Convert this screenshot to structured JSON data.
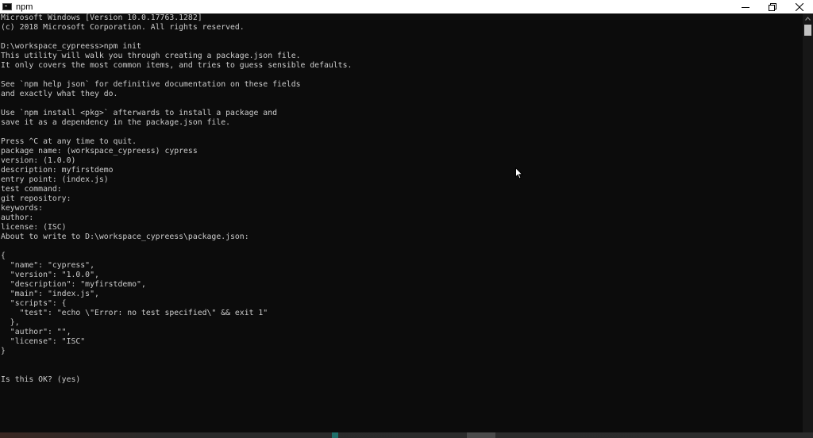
{
  "window": {
    "title": "npm"
  },
  "console": {
    "lines": [
      "Microsoft Windows [Version 10.0.17763.1282]",
      "(c) 2018 Microsoft Corporation. All rights reserved.",
      "",
      "D:\\workspace_cypreess>npm init",
      "This utility will walk you through creating a package.json file.",
      "It only covers the most common items, and tries to guess sensible defaults.",
      "",
      "See `npm help json` for definitive documentation on these fields",
      "and exactly what they do.",
      "",
      "Use `npm install <pkg>` afterwards to install a package and",
      "save it as a dependency in the package.json file.",
      "",
      "Press ^C at any time to quit.",
      "package name: (workspace_cypreess) cypress",
      "version: (1.0.0)",
      "description: myfirstdemo",
      "entry point: (index.js)",
      "test command:",
      "git repository:",
      "keywords:",
      "author:",
      "license: (ISC)",
      "About to write to D:\\workspace_cypreess\\package.json:",
      "",
      "{",
      "  \"name\": \"cypress\",",
      "  \"version\": \"1.0.0\",",
      "  \"description\": \"myfirstdemo\",",
      "  \"main\": \"index.js\",",
      "  \"scripts\": {",
      "    \"test\": \"echo \\\"Error: no test specified\\\" && exit 1\"",
      "  },",
      "  \"author\": \"\",",
      "  \"license\": \"ISC\"",
      "}",
      "",
      "",
      "Is this OK? (yes)"
    ]
  },
  "colors": {
    "console_bg": "#0c0c0c",
    "console_text": "#cccccc",
    "titlebar_bg": "#ffffff"
  },
  "icons": {
    "app": "console-app-icon",
    "minimize": "minimize-icon",
    "restore": "restore-icon",
    "close": "close-icon",
    "cursor": "mouse-pointer-icon"
  }
}
